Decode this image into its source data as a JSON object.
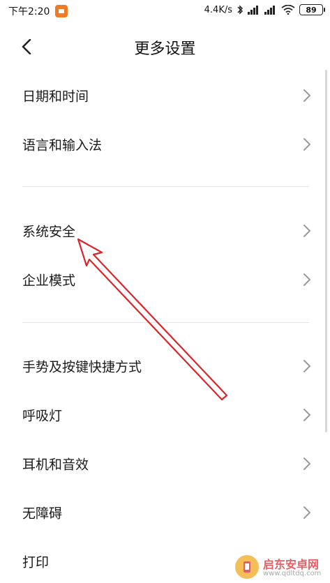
{
  "status_bar": {
    "time": "下午2:20",
    "net_speed": "4.4K/s",
    "battery": "89",
    "icons": [
      "app-notification-icon",
      "bluetooth-icon",
      "signal-icon",
      "signal-icon",
      "wifi-icon",
      "battery-icon"
    ]
  },
  "header": {
    "title": "更多设置",
    "back_icon": "chevron-left-icon"
  },
  "list": {
    "items": [
      {
        "label": "日期和时间"
      },
      {
        "label": "语言和输入法"
      },
      {
        "label": "系统安全"
      },
      {
        "label": "企业模式"
      },
      {
        "label": "手势及按键快捷方式"
      },
      {
        "label": "呼吸灯"
      },
      {
        "label": "耳机和音效"
      },
      {
        "label": "无障碍"
      },
      {
        "label": "打印"
      }
    ]
  },
  "annotation": {
    "arrow_color": "#d9262b",
    "points_to": "系统安全"
  },
  "watermark": {
    "title": "启东安卓网",
    "url": "www.qdltdq.com"
  },
  "colors": {
    "background": "#ffffff",
    "text": "#1a1a1a",
    "chevron": "#9a9a9a",
    "divider": "#e6e6e6"
  }
}
